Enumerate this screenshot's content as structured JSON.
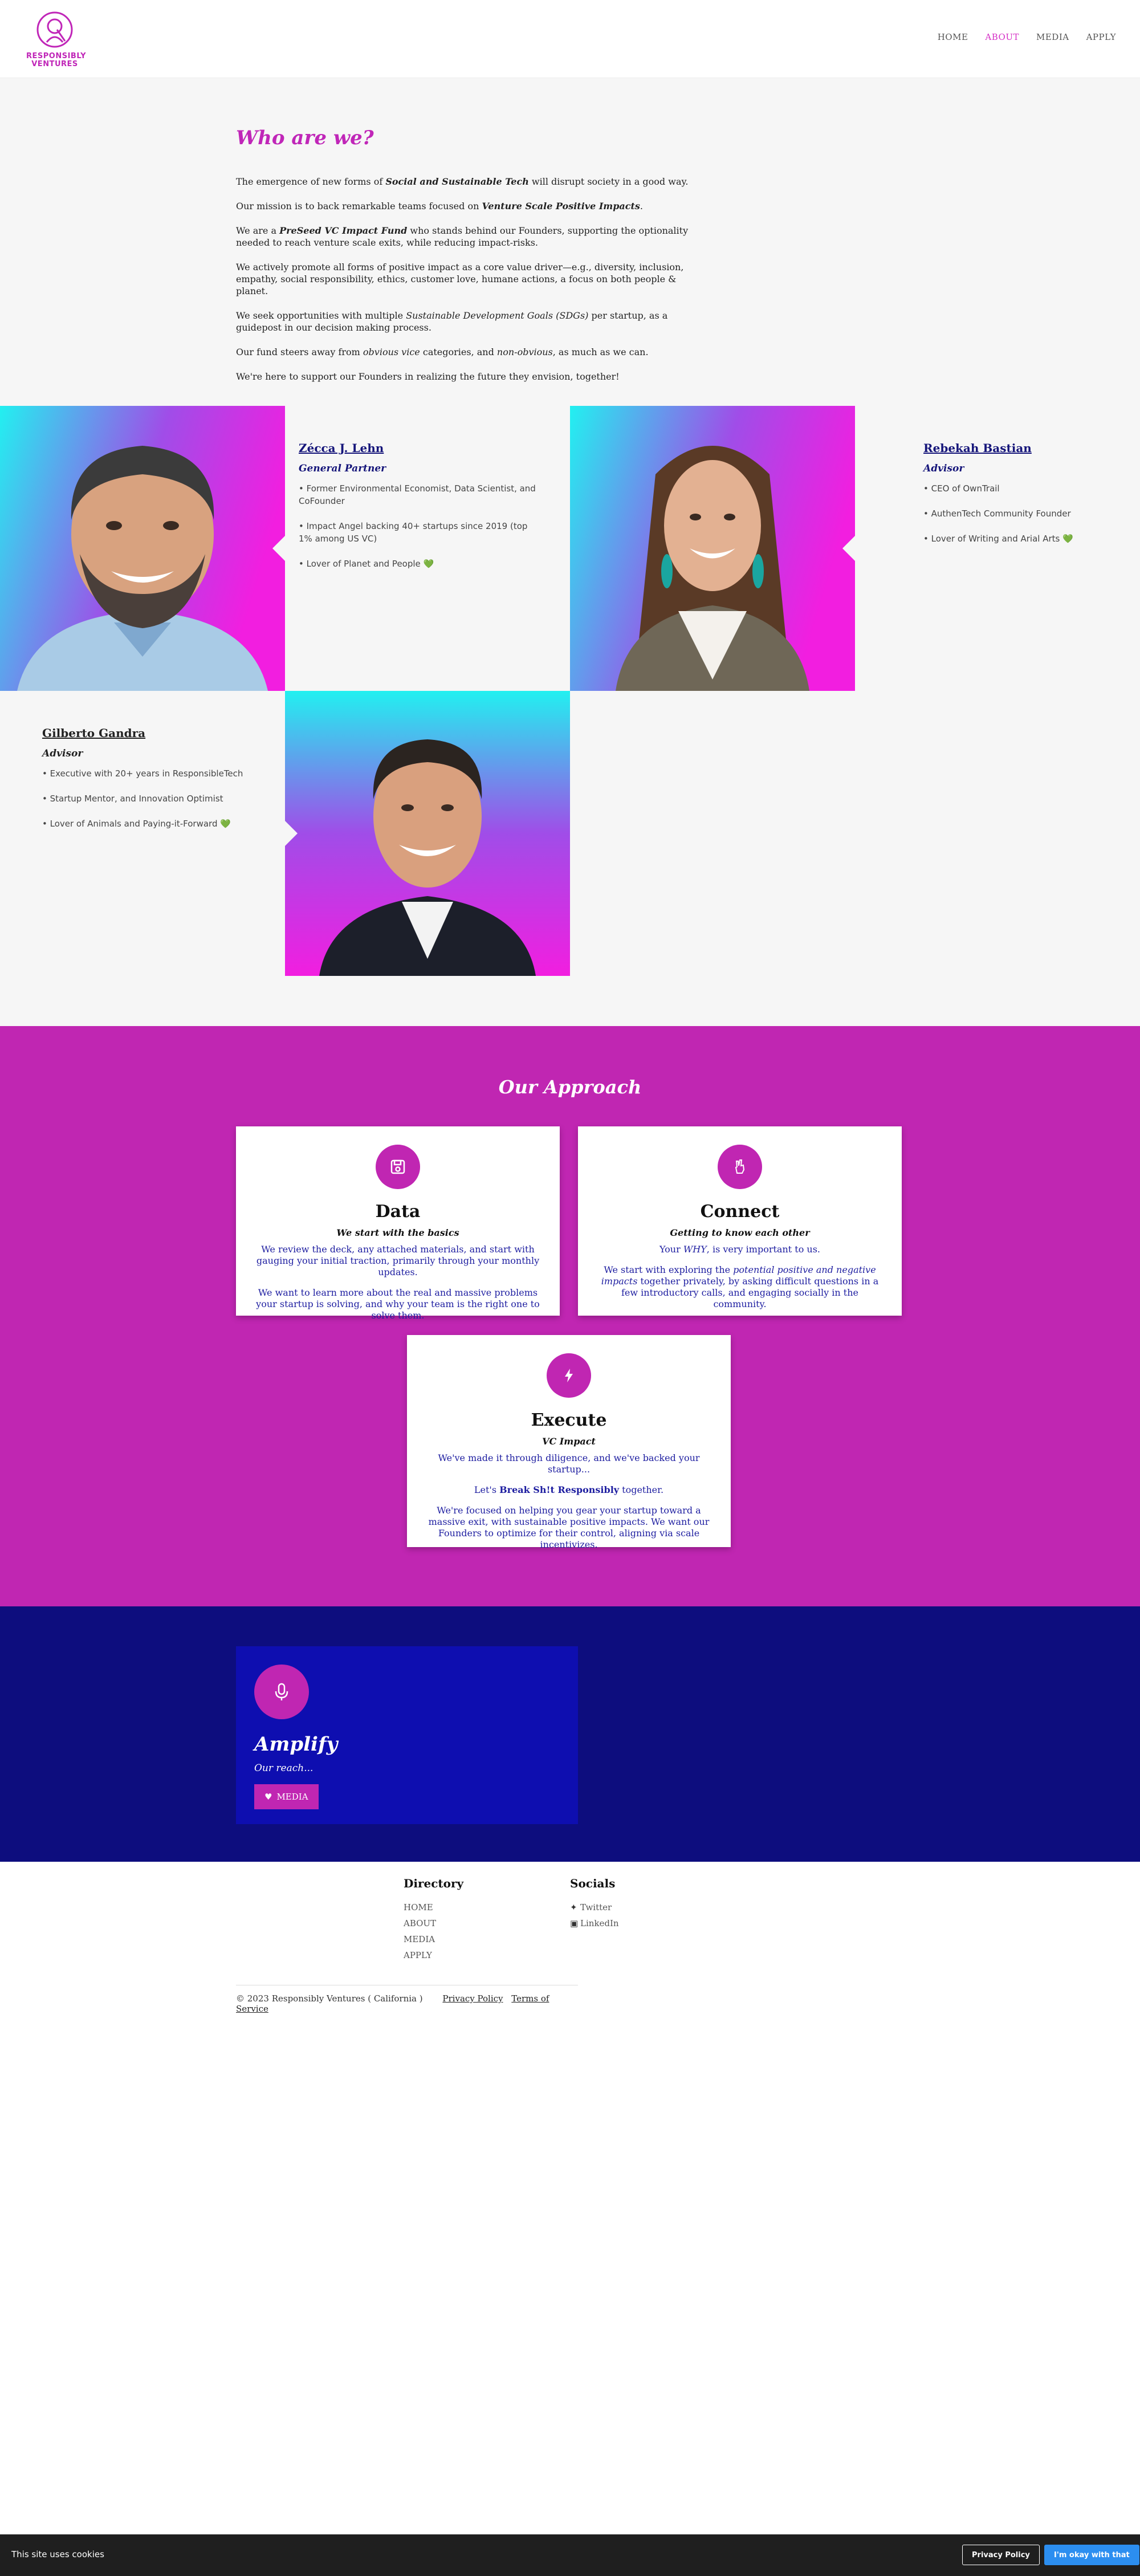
{
  "header": {
    "logo_text_line1": "RESPONSIBLY",
    "logo_text_line2": "VENTURES",
    "nav": [
      "HOME",
      "ABOUT",
      "MEDIA",
      "APPLY"
    ],
    "active_nav": "ABOUT"
  },
  "intro": {
    "title": "Who are we?",
    "p1_pre": "The emergence of new forms of ",
    "p1_em": "Social and Sustainable Tech",
    "p1_post": " will disrupt society in a good way.",
    "p2_pre": "Our mission is to back remarkable teams focused on ",
    "p2_em": "Venture Scale Positive Impacts",
    "p2_post": ".",
    "p3_pre": "We are a ",
    "p3_em": "PreSeed VC Impact Fund",
    "p3_post": " who stands behind our Founders, supporting the optionality needed to reach venture scale exits, while reducing impact-risks.",
    "p4": "We actively promote all forms of positive impact as a core value driver—e.g., diversity, inclusion, empathy, social responsibility, ethics, customer love, humane actions, a focus on both people & planet.",
    "p5_pre": "We seek opportunities with multiple ",
    "p5_em": "Sustainable Development Goals (SDGs)",
    "p5_post": " per startup, as a guidepost in our decision making process.",
    "p6_pre": "Our fund steers away from ",
    "p6_em1": "obvious vice",
    "p6_mid": " categories, and ",
    "p6_em2": "non-obvious",
    "p6_post": ", as much as we can.",
    "p7": "We're here to support our Founders in realizing the future they envision, together!"
  },
  "team": [
    {
      "name": "Zécca J. Lehn",
      "role": "General Partner",
      "bullets": [
        "• Former Environmental Economist, Data Scientist, and CoFounder",
        "• Impact Angel backing 40+ startups since 2019 (top 1% among US VC)",
        "• Lover of Planet and People"
      ]
    },
    {
      "name": "Rebekah Bastian",
      "role": "Advisor",
      "bullets": [
        "• CEO of OwnTrail",
        "• AuthenTech Community Founder",
        "• Lover of Writing and Arial Arts"
      ]
    },
    {
      "name": "Gilberto Gandra",
      "role": "Advisor",
      "bullets": [
        "• Executive with 20+ years in ResponsibleTech",
        "• Startup Mentor, and Innovation Optimist",
        "• Lover of Animals and Paying-it-Forward"
      ]
    }
  ],
  "heart_glyph": "💚",
  "approach": {
    "title": "Our Approach",
    "cards": [
      {
        "title": "Data",
        "subtitle": "We start with the basics",
        "icon": "save-icon",
        "p1": "We review the deck, any attached materials, and start with gauging your initial traction, primarily through your monthly updates.",
        "p2": "We want to learn more about the real and massive problems your startup is solving, and why your team is the right one to solve them."
      },
      {
        "title": "Connect",
        "subtitle": "Getting to know each other",
        "icon": "hand-peace-icon",
        "p1_pre": "Your ",
        "p1_em": "WHY",
        "p1_post": ", is very important to us.",
        "p2_pre": "We start with exploring the ",
        "p2_em": "potential positive and negative impacts",
        "p2_post": " together privately, by asking difficult questions in a few introductory calls, and engaging socially in the community."
      },
      {
        "title": "Execute",
        "subtitle": "VC Impact",
        "icon": "bolt-icon",
        "p1": "We've made it through diligence, and we've backed your startup...",
        "p2_pre": "Let's ",
        "p2_em": "Break Sh!t Responsibly",
        "p2_post": " together.",
        "p3": "We're focused on helping you gear your startup toward a massive exit, with sustainable positive impacts. We want our Founders to optimize for their control, aligning via scale incentivizes."
      }
    ]
  },
  "amplify": {
    "title": "Amplify",
    "subtitle": "Our reach...",
    "button": "MEDIA",
    "icon": "microphone-icon"
  },
  "footer": {
    "directory_title": "Directory",
    "directory_links": [
      "HOME",
      "ABOUT",
      "MEDIA",
      "APPLY"
    ],
    "socials_title": "Socials",
    "socials": [
      {
        "label": "Twitter",
        "icon": "twitter-icon"
      },
      {
        "label": "LinkedIn",
        "icon": "linkedin-icon"
      }
    ],
    "copyright": "© 2023 Responsibly Ventures ( California )",
    "privacy": "Privacy Policy",
    "terms": "Terms of Service"
  },
  "cookie": {
    "text": "This site uses cookies",
    "policy_button": "Privacy Policy",
    "ok_button": "I'm okay with that"
  },
  "colors": {
    "brand_magenta": "#c026b2",
    "accent_navy": "#15157a",
    "amplify_bg": "#0d0d7e",
    "cookie_ok": "#2c8ef0"
  }
}
